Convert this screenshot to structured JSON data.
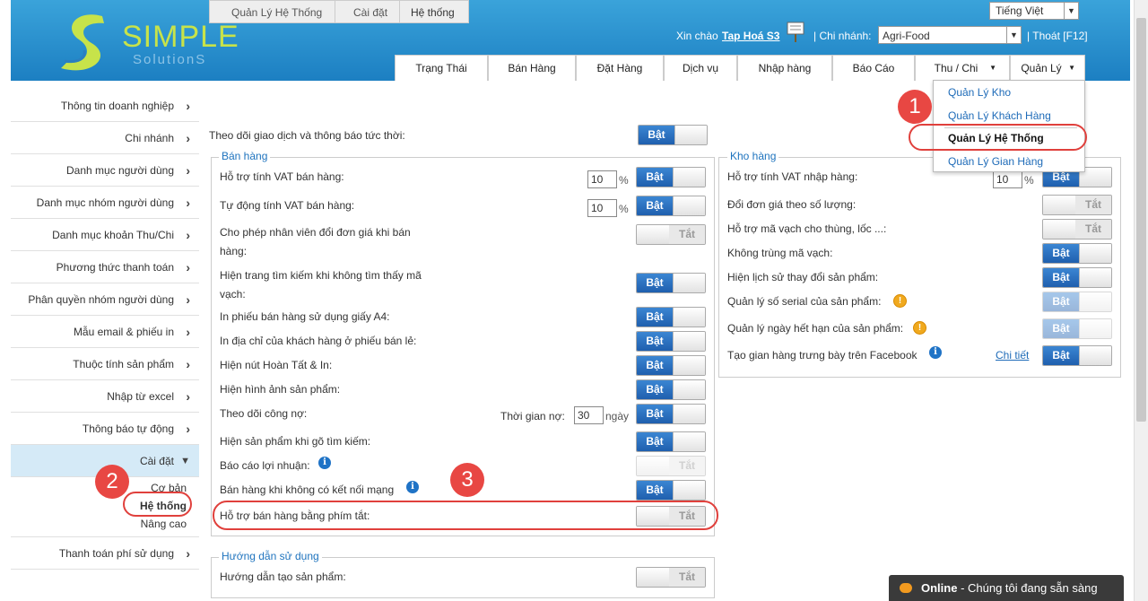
{
  "header": {
    "logo_main": "SIMPLE",
    "logo_sub": "SolutionS",
    "language": "Tiếng Việt",
    "greeting": "Xin chào",
    "user": "Tap Hoá S3",
    "branch_label": "| Chi nhánh:",
    "branch_value": "Agri-Food",
    "logout": "| Thoát [F12]"
  },
  "nav": {
    "tabs": [
      "Trạng Thái",
      "Bán Hàng",
      "Đặt Hàng",
      "Dịch vụ",
      "Nhập hàng",
      "Báo Cáo",
      "Thu / Chi",
      "Quản Lý"
    ]
  },
  "dropdown": {
    "items": [
      "Quản Lý Kho",
      "Quản Lý Khách Hàng",
      "Quản Lý Hệ Thống",
      "Quản Lý Gian Hàng"
    ]
  },
  "sidebar": {
    "items": [
      "Thông tin doanh nghiệp",
      "Chi nhánh",
      "Danh mục người dùng",
      "Danh mục nhóm người dùng",
      "Danh mục khoản Thu/Chi",
      "Phương thức thanh toán",
      "Phân quyền nhóm người dùng",
      "Mẫu email & phiếu in",
      "Thuộc tính sản phẩm",
      "Nhập từ excel",
      "Thông báo tự động"
    ],
    "active": "Cài đặt",
    "sub": [
      "Cơ bản",
      "Hệ thống",
      "Nâng cao"
    ],
    "last": "Thanh toán phí sử dụng"
  },
  "breadcrumb": [
    "Quản Lý Hệ Thống",
    "Cài đặt",
    "Hệ thống"
  ],
  "toggle_text": {
    "on": "Bật",
    "off": "Tắt"
  },
  "top_setting": {
    "label": "Theo dõi giao dịch và thông báo tức thời:",
    "state": "on"
  },
  "sales": {
    "legend": "Bán hàng",
    "rows": [
      {
        "label": "Hỗ trợ tính VAT bán hàng:",
        "state": "on",
        "value": "10",
        "unit": "%"
      },
      {
        "label": "Tự động tính VAT bán hàng:",
        "state": "on",
        "value": "10",
        "unit": "%"
      },
      {
        "label": "Cho phép nhân viên đổi đơn giá khi bán",
        "label2": "hàng:",
        "state": "off"
      },
      {
        "label": "Hiện trang tìm kiếm khi không tìm thấy mã",
        "label2": "vạch:",
        "state": "on"
      },
      {
        "label": "In phiếu bán hàng sử dụng giấy A4:",
        "state": "on"
      },
      {
        "label": "In địa chỉ của khách hàng ở phiếu bán lẻ:",
        "state": "on"
      },
      {
        "label": "Hiện nút Hoàn Tất & In:",
        "state": "on"
      },
      {
        "label": "Hiện hình ảnh sản phẩm:",
        "state": "on"
      },
      {
        "label": "Theo dõi công nợ:",
        "state": "on",
        "extra_label": "Thời gian nợ:",
        "value": "30",
        "unit": "ngày"
      },
      {
        "label": "Hiện sản phẩm khi gõ tìm kiếm:",
        "state": "on"
      },
      {
        "label": "Báo cáo lợi nhuận:",
        "state": "off-disabled"
      },
      {
        "label": "Bán hàng khi không có kết nối mạng",
        "state": "on"
      },
      {
        "label": "Hỗ trợ bán hàng bằng phím tắt:",
        "state": "off"
      }
    ]
  },
  "guide": {
    "legend": "Hướng dẫn sử dụng",
    "rows": [
      {
        "label": "Hướng dẫn tạo sản phẩm:",
        "state": "off"
      }
    ]
  },
  "warehouse": {
    "legend": "Kho hàng",
    "rows": [
      {
        "label": "Hỗ trợ tính VAT nhập hàng:",
        "state": "on",
        "value": "10",
        "unit": "%"
      },
      {
        "label": "Đổi đơn giá theo số lượng:",
        "state": "off"
      },
      {
        "label": "Hỗ trợ mã vạch cho thùng, lốc ...:",
        "state": "off"
      },
      {
        "label": "Không trùng mã vạch:",
        "state": "on"
      },
      {
        "label": "Hiện lịch sử thay đổi sản phẩm:",
        "state": "on"
      },
      {
        "label": "Quản lý số serial của sản phẩm:",
        "state": "on-disabled"
      },
      {
        "label": "Quản lý ngày hết hạn của sản phẩm:",
        "state": "on-disabled"
      },
      {
        "label": "Tạo gian hàng trưng bày trên Facebook",
        "state": "on",
        "link": "Chi tiết"
      }
    ]
  },
  "annotations": [
    "1",
    "2",
    "3"
  ],
  "chat": {
    "status": "Online",
    "message": " - Chúng tôi đang sẵn sàng"
  },
  "colors": {
    "header": "#2b93d1",
    "accent": "#1f5fae",
    "logo": "#c7e34a",
    "annotation": "#e84743"
  }
}
